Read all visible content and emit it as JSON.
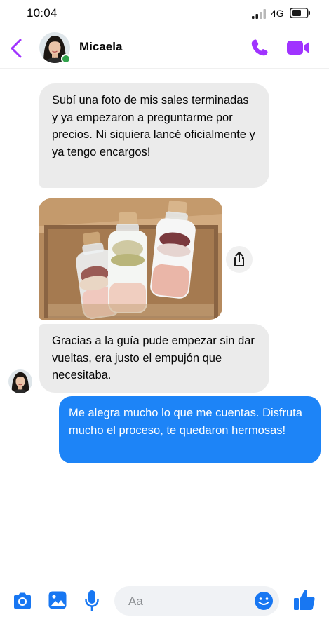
{
  "status_bar": {
    "time": "10:04",
    "network": "4G",
    "icons": [
      "signal-icon",
      "battery-icon"
    ]
  },
  "header": {
    "contact_name": "Micaela",
    "icons": [
      "back-chevron-icon",
      "phone-icon",
      "video-camera-icon"
    ],
    "online": true
  },
  "messages": [
    {
      "direction": "incoming",
      "text": "Subí una foto de mis sales terminadas y ya empezaron a preguntarme por precios. Ni siquiera lancé oficialmente y ya tengo encargos!"
    },
    {
      "direction": "incoming",
      "type": "photo",
      "icon": "share-icon"
    },
    {
      "direction": "incoming",
      "text": "Gracias a la guía pude empezar sin dar vueltas, era justo el empujón que necesitaba."
    },
    {
      "direction": "outgoing",
      "text": "Me alegra mucho lo que me cuentas. Disfruta mucho el proceso, te quedaron hermosas!"
    }
  ],
  "composer": {
    "placeholder": "Aa",
    "icons": [
      "camera-icon",
      "gallery-icon",
      "microphone-icon",
      "emoji-icon",
      "thumbs-up-icon"
    ]
  },
  "colors": {
    "accent_purple": "#a033ff",
    "outgoing_bubble": "#1d84f7",
    "incoming_bubble": "#ebebeb",
    "composer_blue": "#1877f2",
    "online_green": "#31a24c"
  }
}
